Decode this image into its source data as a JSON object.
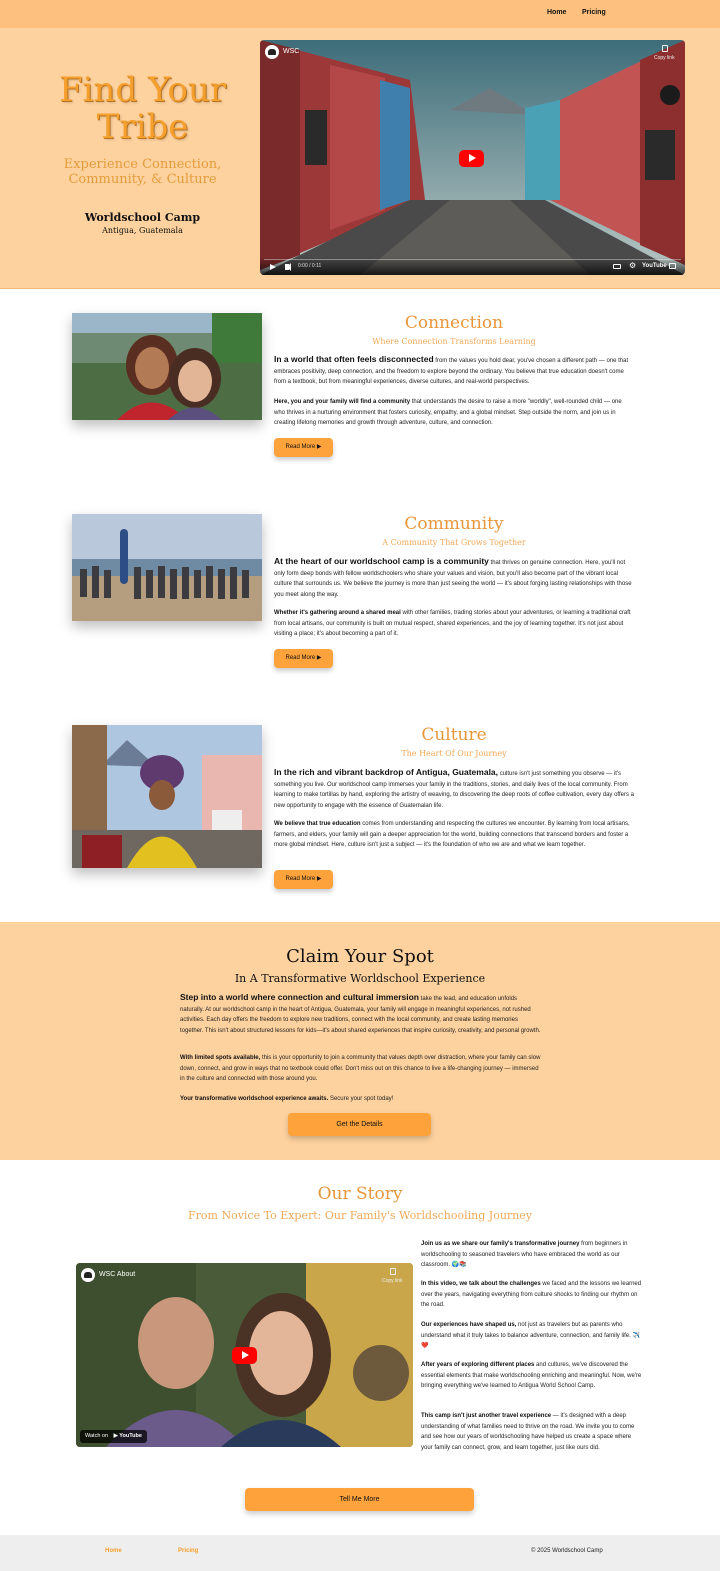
{
  "nav": {
    "home": "Home",
    "pricing": "Pricing"
  },
  "hero": {
    "title": "Find Your Tribe",
    "subtitle": "Experience Connection, Community, & Culture",
    "camp_name": "Worldschool Camp",
    "location": "Antigua, Guatemala",
    "video": {
      "channel_title": "WSC",
      "copy_link": "Copy link",
      "time": "0:00 / 0:11",
      "brand": "YouTube"
    }
  },
  "sections": [
    {
      "title": "Connection",
      "subtitle": "Where Connection Transforms Learning",
      "p1_lead": "In a world that often feels disconnected",
      "p1_rest": " from the values you hold dear, you've chosen a different path — one that embraces positivity, deep connection, and the freedom to explore beyond the ordinary. You believe that true education doesn't come from a textbook, but from meaningful experiences, diverse cultures, and real-world perspectives.",
      "p2_bold": "Here, you and your family will find a community",
      "p2_rest": " that understands the desire to raise a more \"worldly\", well-rounded child — one who thrives in a nurturing environment that fosters curiosity, empathy, and a global mindset. Step outside the norm, and join us in creating lifelong memories and growth through adventure, culture, and connection.",
      "button": "Read More ▶"
    },
    {
      "title": "Community",
      "subtitle": "A Community That Grows Together",
      "p1_lead": "At the heart of our worldschool camp is a community",
      "p1_rest": " that thrives on genuine connection. Here, you'll not only form deep bonds with fellow worldschoolers who share your values and vision, but you'll also become part of the vibrant local culture that surrounds us. We believe the journey is more than just seeing the world — it's about forging lasting relationships with those you meet along the way.",
      "p2_bold": "Whether it's gathering around a shared meal",
      "p2_rest": " with other families, trading stories about your adventures, or learning a traditional craft from local artisans, our community is built on mutual respect, shared experiences, and the joy of learning together. It's not just about visiting a place; it's about becoming a part of it.",
      "button": "Read More ▶"
    },
    {
      "title": "Culture",
      "subtitle": "The Heart Of Our Journey",
      "p1_lead": "In the rich and vibrant backdrop of Antigua, Guatemala,",
      "p1_rest": " culture isn't just something you observe — it's something you live. Our worldschool camp immerses your family in the traditions, stories, and daily lives of the local community. From learning to make tortillas by hand, exploring the artistry of weaving, to discovering the deep roots of coffee cultivation, every day offers a new opportunity to engage with the essence of Guatemalan life.",
      "p2_bold": "We believe that true education",
      "p2_rest": " comes from understanding and respecting the cultures we encounter. By learning from local artisans, farmers, and elders, your family will gain a deeper appreciation for the world, building connections that transcend borders and foster a more global mindset. Here, culture isn't just a subject — it's the foundation of who we are and what we learn together.",
      "button": "Read More ▶"
    }
  ],
  "claim": {
    "title": "Claim Your Spot",
    "subtitle": "In A Transformative Worldschool Experience",
    "p1_lead": "Step into a world where connection and cultural immersion",
    "p1_rest": " take the lead, and education unfolds naturally. At our worldschool camp in the heart of Antigua, Guatemala, your family will engage in meaningful experiences, not rushed activities. Each day offers the freedom to explore new traditions, connect with the local community, and create lasting memories together. This isn't about structured lessons for kids—it's about shared experiences that inspire curiosity, creativity, and personal growth.",
    "p2_bold": "With limited spots available,",
    "p2_rest": " this is your opportunity to join a community that values depth over distraction, where your family can slow down, connect, and grow in ways that no textbook could offer. Don't miss out on this chance to live a life-changing journey — immersed in the culture and connected with those around you.",
    "p3_bold": "Your transformative worldschool experience awaits.",
    "p3_rest": " Secure your spot today!",
    "button": "Get the Details"
  },
  "story": {
    "title": "Our Story",
    "subtitle": "From Novice To Expert: Our Family's Worldschooling Journey",
    "video": {
      "channel_title": "WSC About",
      "copy_link": "Copy link",
      "watch_on": "Watch on",
      "brand": "YouTube"
    },
    "paragraphs": [
      {
        "bold": "Join us as we share our family's transformative journey",
        "rest": " from beginners in worldschooling to seasoned travelers who have embraced the world as our classroom. 🌍📚"
      },
      {
        "bold": "In this video, we talk about the challenges",
        "rest": " we faced and the lessons we learned over the years, navigating everything from culture shocks to finding our rhythm on the road."
      },
      {
        "bold": "Our experiences have shaped us,",
        "rest": " not just as travelers but as parents who understand what it truly takes to balance adventure, connection, and family life. ✈️❤️"
      },
      {
        "bold": "After years of exploring different places",
        "rest": " and cultures, we've discovered the essential elements that make worldschooling enriching and meaningful. Now, we're bringing everything we've learned to Antigua World School Camp."
      },
      {
        "bold": "This camp isn't just another travel experience",
        "rest": " — it's designed with a deep understanding of what families need to thrive on the road. We invite you to come and see how our years of worldschooling have helped us create a space where your family can connect, grow, and learn together, just like ours did."
      }
    ],
    "button": "Tell Me More"
  },
  "footer": {
    "home": "Home",
    "pricing": "Pricing",
    "copyright": "© 2025 Worldschool Camp"
  }
}
